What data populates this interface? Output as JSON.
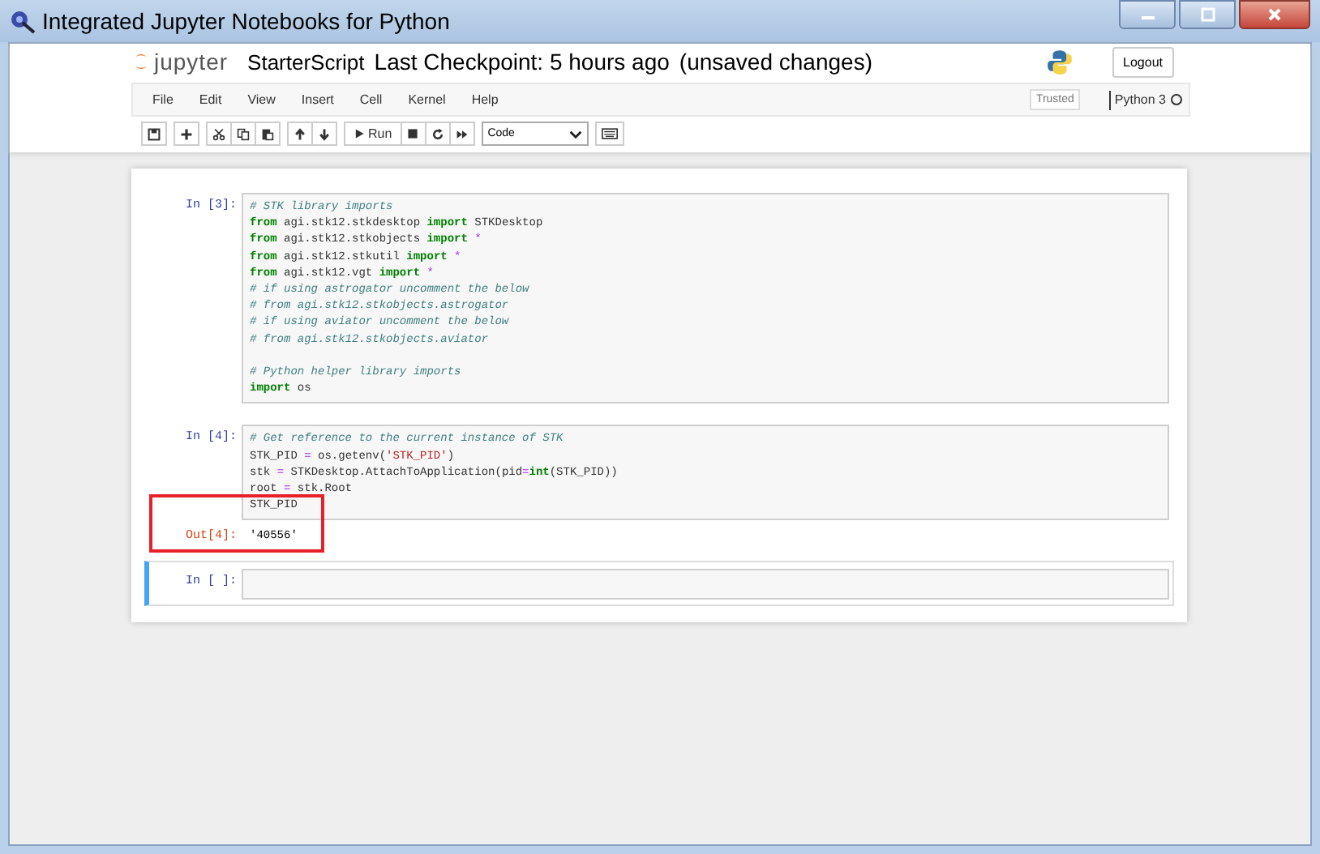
{
  "window": {
    "title": "Integrated Jupyter Notebooks for Python"
  },
  "header": {
    "logo_text": "jupyter",
    "notebook_name": "StarterScript",
    "checkpoint": "Last Checkpoint: 5 hours ago",
    "autosave_status": "(unsaved changes)",
    "logout_label": "Logout"
  },
  "menu": {
    "items": [
      "File",
      "Edit",
      "View",
      "Insert",
      "Cell",
      "Kernel",
      "Help"
    ],
    "trusted_label": "Trusted",
    "kernel_name": "Python 3",
    "kernel_busy": false
  },
  "toolbar": {
    "run_label": "Run",
    "cell_type": "Code"
  },
  "cells": [
    {
      "prompt": "In [3]:",
      "selected": false,
      "lines": [
        {
          "kind": "code",
          "tokens": [
            {
              "text": "# STK library imports",
              "kind": "comment"
            }
          ]
        },
        {
          "kind": "code",
          "tokens": [
            {
              "text": "from",
              "kind": "keyword"
            },
            {
              "text": " agi.stk12.stkdesktop ",
              "kind": "name"
            },
            {
              "text": "import",
              "kind": "keyword"
            },
            {
              "text": " STKDesktop",
              "kind": "name"
            }
          ]
        },
        {
          "kind": "code",
          "tokens": [
            {
              "text": "from",
              "kind": "keyword"
            },
            {
              "text": " agi.stk12.stkobjects ",
              "kind": "name"
            },
            {
              "text": "import",
              "kind": "keyword"
            },
            {
              "text": " *",
              "kind": "operator"
            }
          ]
        },
        {
          "kind": "code",
          "tokens": [
            {
              "text": "from",
              "kind": "keyword"
            },
            {
              "text": " agi.stk12.stkutil ",
              "kind": "name"
            },
            {
              "text": "import",
              "kind": "keyword"
            },
            {
              "text": " *",
              "kind": "operator"
            }
          ]
        },
        {
          "kind": "code",
          "tokens": [
            {
              "text": "from",
              "kind": "keyword"
            },
            {
              "text": " agi.stk12.vgt ",
              "kind": "name"
            },
            {
              "text": "import",
              "kind": "keyword"
            },
            {
              "text": " *",
              "kind": "operator"
            }
          ]
        },
        {
          "kind": "code",
          "tokens": [
            {
              "text": "# if using astrogator uncomment the below",
              "kind": "comment"
            }
          ]
        },
        {
          "kind": "code",
          "tokens": [
            {
              "text": "# from agi.stk12.stkobjects.astrogator",
              "kind": "comment"
            }
          ]
        },
        {
          "kind": "code",
          "tokens": [
            {
              "text": "# if using aviator uncomment the below",
              "kind": "comment"
            }
          ]
        },
        {
          "kind": "code",
          "tokens": [
            {
              "text": "# from agi.stk12.stkobjects.aviator",
              "kind": "comment"
            }
          ]
        },
        {
          "kind": "blank"
        },
        {
          "kind": "code",
          "tokens": [
            {
              "text": "# Python helper library imports",
              "kind": "comment"
            }
          ]
        },
        {
          "kind": "code",
          "tokens": [
            {
              "text": "import",
              "kind": "keyword"
            },
            {
              "text": " os",
              "kind": "name"
            }
          ]
        }
      ]
    },
    {
      "prompt": "In [4]:",
      "selected": false,
      "highlighted": true,
      "lines": [
        {
          "kind": "code",
          "tokens": [
            {
              "text": "# Get reference to the current instance of STK",
              "kind": "comment"
            }
          ]
        },
        {
          "kind": "code",
          "tokens": [
            {
              "text": "STK_PID ",
              "kind": "name"
            },
            {
              "text": "=",
              "kind": "operator"
            },
            {
              "text": " os.getenv(",
              "kind": "name"
            },
            {
              "text": "'STK_PID'",
              "kind": "string"
            },
            {
              "text": ")",
              "kind": "name"
            }
          ]
        },
        {
          "kind": "code",
          "tokens": [
            {
              "text": "stk ",
              "kind": "name"
            },
            {
              "text": "=",
              "kind": "operator"
            },
            {
              "text": " STKDesktop.AttachToApplication(pid",
              "kind": "name"
            },
            {
              "text": "=",
              "kind": "operator"
            },
            {
              "text": "int",
              "kind": "builtin"
            },
            {
              "text": "(STK_PID))",
              "kind": "name"
            }
          ]
        },
        {
          "kind": "code",
          "tokens": [
            {
              "text": "root ",
              "kind": "name"
            },
            {
              "text": "=",
              "kind": "operator"
            },
            {
              "text": " stk.Root",
              "kind": "name"
            }
          ]
        },
        {
          "kind": "code",
          "tokens": [
            {
              "text": "STK_PID",
              "kind": "name"
            }
          ]
        }
      ],
      "output_prompt": "Out[4]:",
      "output": "'40556'"
    },
    {
      "prompt": "In [ ]:",
      "selected": true
    }
  ]
}
